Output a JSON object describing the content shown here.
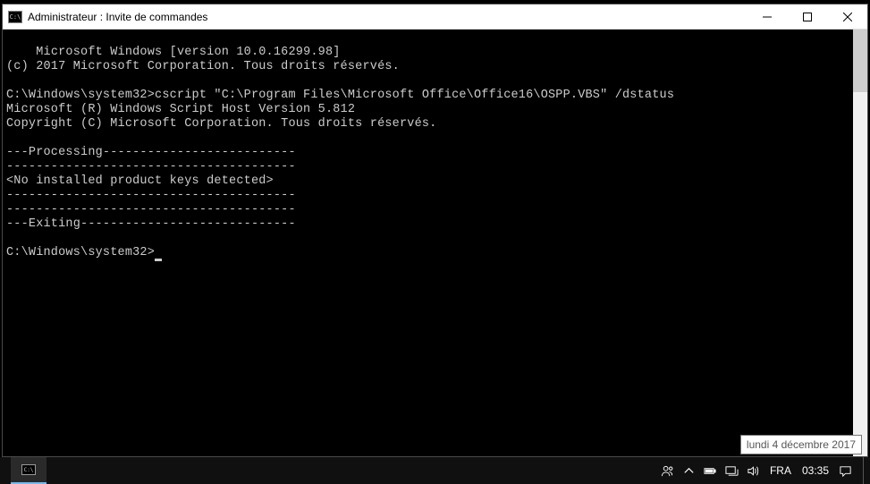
{
  "window": {
    "title": "Administrateur : Invite de commandes",
    "icon_label": "cmd-icon"
  },
  "console": {
    "lines": [
      "Microsoft Windows [version 10.0.16299.98]",
      "(c) 2017 Microsoft Corporation. Tous droits réservés.",
      "",
      "C:\\Windows\\system32>cscript \"C:\\Program Files\\Microsoft Office\\Office16\\OSPP.VBS\" /dstatus",
      "Microsoft (R) Windows Script Host Version 5.812",
      "Copyright (C) Microsoft Corporation. Tous droits réservés.",
      "",
      "---Processing--------------------------",
      "---------------------------------------",
      "<No installed product keys detected>",
      "---------------------------------------",
      "---------------------------------------",
      "---Exiting-----------------------------",
      "",
      "C:\\Windows\\system32>"
    ]
  },
  "taskbar": {
    "language": "FRA",
    "clock": "03:35",
    "tooltip": "lundi 4 décembre 2017"
  }
}
